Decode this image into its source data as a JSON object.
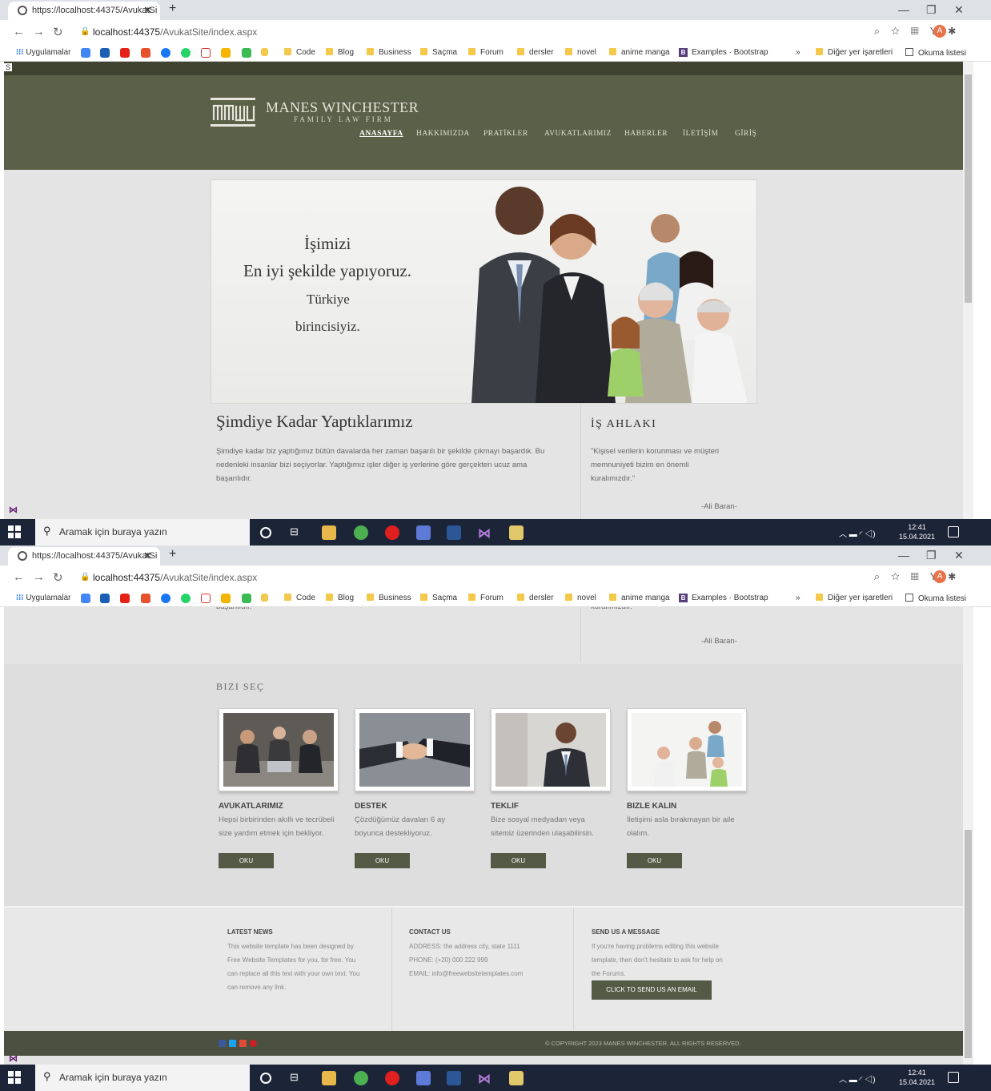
{
  "browser": {
    "tab_title": "https://localhost:44375/AvukatSi",
    "tab_close": "✕",
    "new_tab": "+",
    "url_host": "localhost:44375",
    "url_path": "/AvukatSite/index.aspx",
    "avatar_letter": "A",
    "bookmarks": [
      "Uygulamalar",
      "Code",
      "Blog",
      "Business",
      "Saçma",
      "Forum",
      "dersler",
      "novel",
      "anime manga",
      "Examples · Bootstrap",
      "»",
      "Diğer yer işaretleri",
      "Okuma listesi"
    ]
  },
  "site": {
    "top_letter": "S",
    "firm_name": "MANES WINCHESTER",
    "firm_sub": "FAMILY LAW FIRM",
    "menu": [
      "ANASAYFA",
      "HAKKIMIZDA",
      "PRATİKLER",
      "AVUKATLARIMIZ",
      "HABERLER",
      "İLETİŞİM",
      "GİRİŞ"
    ],
    "hero": {
      "line1": "İşimizi",
      "line2": "En iyi şekilde yapıyoruz.",
      "line3": "Türkiye",
      "line4": "birincisiyiz."
    },
    "done_title": "Şimdiye Kadar Yaptıklarımız",
    "done_p1": "Şimdiye kadar biz yaptığımız bütün davalarda her zaman başarılı bir şekilde çıkmayı başardık. Bu",
    "done_p2": "nedenleki insanlar bizi seçiyorlar. Yaptığımız işler diğer iş yerlerine göre gerçekten ucuz ama",
    "done_p3": "başarılıdır.",
    "ethics_title": "İŞ AHLAKI",
    "ethics_p1": "\"Kişisel verilerin korunması ve müşteri",
    "ethics_p2": "memnuniyeti bizim en önemli",
    "ethics_p3": "kuralımızdır.\"",
    "ethics_author": "-Ali Baran-",
    "cut_left": "başarılıdır.",
    "cut_right": "kuralımızdır.\"",
    "choose_title": "BIZI SEÇ",
    "cards": [
      {
        "title": "AVUKATLARIMIZ",
        "l1": "Hepsi birbirinden akıllı ve tecrübeli",
        "l2": "size yardım etmek için bekliyor.",
        "btn": "OKU"
      },
      {
        "title": "DESTEK",
        "l1": "Çözdüğümüz davaları 6 ay",
        "l2": "boyunca destekliyoruz.",
        "btn": "OKU"
      },
      {
        "title": "TEKLIF",
        "l1": "Bize sosyal medyadan veya",
        "l2": "sitemiz üzerinden ulaşabilirsin.",
        "btn": "OKU"
      },
      {
        "title": "BIZLE KALIN",
        "l1": "İletişimi asla bırakmayan bir aile",
        "l2": "olalım.",
        "btn": "OKU"
      }
    ],
    "footer": {
      "news_title": "LATEST NEWS",
      "news": [
        "This website template has been designed by",
        "Free Website Templates for you, for free. You",
        "can replace all this text with your own text. You",
        "can remove any link."
      ],
      "contact_title": "CONTACT US",
      "contact": [
        "ADDRESS: the address city, state 1111",
        "PHONE: (+20) 000 222 999",
        "EMAIL: info@freewebsitetemplates.com"
      ],
      "msg_title": "SEND US A MESSAGE",
      "msg": [
        "If you're having problems editing this website",
        "template, then don't hesitate to ask for help on",
        "the Forums."
      ],
      "msg_btn": "CLICK TO SEND US AN EMAIL",
      "copyright": "© COPYRIGHT 2023 MANES WINCHESTER. ALL RIGHTS RESERVED."
    }
  },
  "taskbar": {
    "search_placeholder": "Aramak için buraya yazın",
    "time": "12:41",
    "date": "15.04.2021"
  },
  "colors": {
    "header": "#5b6148",
    "button": "#555a47",
    "taskbar": "#1c2438"
  }
}
